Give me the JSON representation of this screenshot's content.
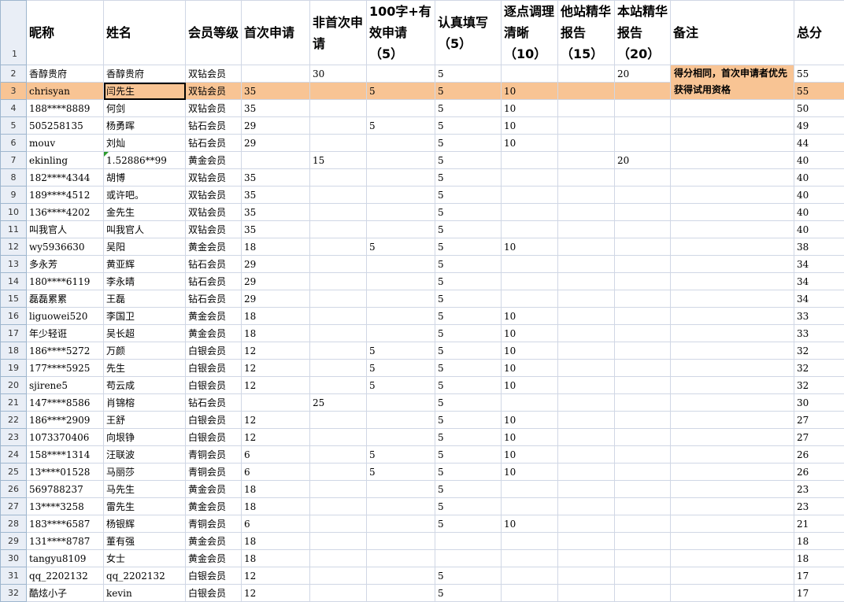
{
  "headers": [
    "昵称",
    "姓名",
    "会员等级",
    "首次申请",
    "非首次申请",
    "100字+有效申请（5）",
    "认真填写（5）",
    "逐点调理清晰（10）",
    "他站精华报告（15）",
    "本站精华报告（20）",
    "备注",
    "总分"
  ],
  "header_row_number": "1",
  "note": "得分相同，首次申请者优先获得试用资格",
  "rows": [
    {
      "n": "2",
      "c": [
        "香醇贵府",
        "香醇贵府",
        "双钻会员",
        "",
        "30",
        "",
        "5",
        "",
        "",
        "20",
        "",
        "55"
      ]
    },
    {
      "n": "3",
      "c": [
        "chrisyan",
        "闫先生",
        "双钻会员",
        "35",
        "",
        "5",
        "5",
        "10",
        "",
        "",
        "",
        "55"
      ]
    },
    {
      "n": "4",
      "c": [
        "188****8889",
        "何剑",
        "双钻会员",
        "35",
        "",
        "",
        "5",
        "10",
        "",
        "",
        "",
        "50"
      ]
    },
    {
      "n": "5",
      "c": [
        "505258135",
        "杨勇晖",
        "钻石会员",
        "29",
        "",
        "5",
        "5",
        "10",
        "",
        "",
        "",
        "49"
      ]
    },
    {
      "n": "6",
      "c": [
        "mouv",
        "刘灿",
        "钻石会员",
        "29",
        "",
        "",
        "5",
        "10",
        "",
        "",
        "",
        "44"
      ]
    },
    {
      "n": "7",
      "c": [
        "ekinling",
        "1.52886**99",
        "黄金会员",
        "",
        "15",
        "",
        "5",
        "",
        "",
        "20",
        "",
        "40"
      ]
    },
    {
      "n": "8",
      "c": [
        "182****4344",
        "胡博",
        "双钻会员",
        "35",
        "",
        "",
        "5",
        "",
        "",
        "",
        "",
        "40"
      ]
    },
    {
      "n": "9",
      "c": [
        "189****4512",
        "或许吧。",
        "双钻会员",
        "35",
        "",
        "",
        "5",
        "",
        "",
        "",
        "",
        "40"
      ]
    },
    {
      "n": "10",
      "c": [
        "136****4202",
        "金先生",
        "双钻会员",
        "35",
        "",
        "",
        "5",
        "",
        "",
        "",
        "",
        "40"
      ]
    },
    {
      "n": "11",
      "c": [
        "叫我官人",
        "叫我官人",
        "双钻会员",
        "35",
        "",
        "",
        "5",
        "",
        "",
        "",
        "",
        "40"
      ]
    },
    {
      "n": "12",
      "c": [
        "wy5936630",
        "吴阳",
        "黄金会员",
        "18",
        "",
        "5",
        "5",
        "10",
        "",
        "",
        "",
        "38"
      ]
    },
    {
      "n": "13",
      "c": [
        "多永芳",
        "黄亚辉",
        "钻石会员",
        "29",
        "",
        "",
        "5",
        "",
        "",
        "",
        "",
        "34"
      ]
    },
    {
      "n": "14",
      "c": [
        "180****6119",
        "李永晴",
        "钻石会员",
        "29",
        "",
        "",
        "5",
        "",
        "",
        "",
        "",
        "34"
      ]
    },
    {
      "n": "15",
      "c": [
        "磊磊累累",
        "王磊",
        "钻石会员",
        "29",
        "",
        "",
        "5",
        "",
        "",
        "",
        "",
        "34"
      ]
    },
    {
      "n": "16",
      "c": [
        "liguowei520",
        "李国卫",
        "黄金会员",
        "18",
        "",
        "",
        "5",
        "10",
        "",
        "",
        "",
        "33"
      ]
    },
    {
      "n": "17",
      "c": [
        "年少轻诳",
        "吴长超",
        "黄金会员",
        "18",
        "",
        "",
        "5",
        "10",
        "",
        "",
        "",
        "33"
      ]
    },
    {
      "n": "18",
      "c": [
        "186****5272",
        "万颜",
        "白银会员",
        "12",
        "",
        "5",
        "5",
        "10",
        "",
        "",
        "",
        "32"
      ]
    },
    {
      "n": "19",
      "c": [
        "177****5925",
        "先生",
        "白银会员",
        "12",
        "",
        "5",
        "5",
        "10",
        "",
        "",
        "",
        "32"
      ]
    },
    {
      "n": "20",
      "c": [
        "sjirene5",
        "苟云成",
        "白银会员",
        "12",
        "",
        "5",
        "5",
        "10",
        "",
        "",
        "",
        "32"
      ]
    },
    {
      "n": "21",
      "c": [
        "147****8586",
        "肖锦榕",
        "钻石会员",
        "",
        "25",
        "",
        "5",
        "",
        "",
        "",
        "",
        "30"
      ]
    },
    {
      "n": "22",
      "c": [
        "186****2909",
        "王舒",
        "白银会员",
        "12",
        "",
        "",
        "5",
        "10",
        "",
        "",
        "",
        "27"
      ]
    },
    {
      "n": "23",
      "c": [
        "1073370406",
        "向垠铮",
        "白银会员",
        "12",
        "",
        "",
        "5",
        "10",
        "",
        "",
        "",
        "27"
      ]
    },
    {
      "n": "24",
      "c": [
        "158****1314",
        "汪联波",
        "青铜会员",
        "6",
        "",
        "5",
        "5",
        "10",
        "",
        "",
        "",
        "26"
      ]
    },
    {
      "n": "25",
      "c": [
        "13****01528",
        "马丽莎",
        "青铜会员",
        "6",
        "",
        "5",
        "5",
        "10",
        "",
        "",
        "",
        "26"
      ]
    },
    {
      "n": "26",
      "c": [
        "569788237",
        "马先生",
        "黄金会员",
        "18",
        "",
        "",
        "5",
        "",
        "",
        "",
        "",
        "23"
      ]
    },
    {
      "n": "27",
      "c": [
        "13****3258",
        "雷先生",
        "黄金会员",
        "18",
        "",
        "",
        "5",
        "",
        "",
        "",
        "",
        "23"
      ]
    },
    {
      "n": "28",
      "c": [
        "183****6587",
        "杨银辉",
        "青铜会员",
        "6",
        "",
        "",
        "5",
        "10",
        "",
        "",
        "",
        "21"
      ]
    },
    {
      "n": "29",
      "c": [
        "131****8787",
        "董有强",
        "黄金会员",
        "18",
        "",
        "",
        "",
        "",
        "",
        "",
        "",
        "18"
      ]
    },
    {
      "n": "30",
      "c": [
        "tangyu8109",
        "女士",
        "黄金会员",
        "18",
        "",
        "",
        "",
        "",
        "",
        "",
        "",
        "18"
      ]
    },
    {
      "n": "31",
      "c": [
        "qq_2202132",
        "qq_2202132",
        "白银会员",
        "12",
        "",
        "",
        "5",
        "",
        "",
        "",
        "",
        "17"
      ]
    },
    {
      "n": "32",
      "c": [
        "酷炫小子",
        "kevin",
        "白银会员",
        "12",
        "",
        "",
        "5",
        "",
        "",
        "",
        "",
        "17"
      ]
    }
  ],
  "colors": {
    "selected_row": "#f8c494",
    "grid": "#d0d7e5",
    "row_header": "#e9eef6"
  }
}
